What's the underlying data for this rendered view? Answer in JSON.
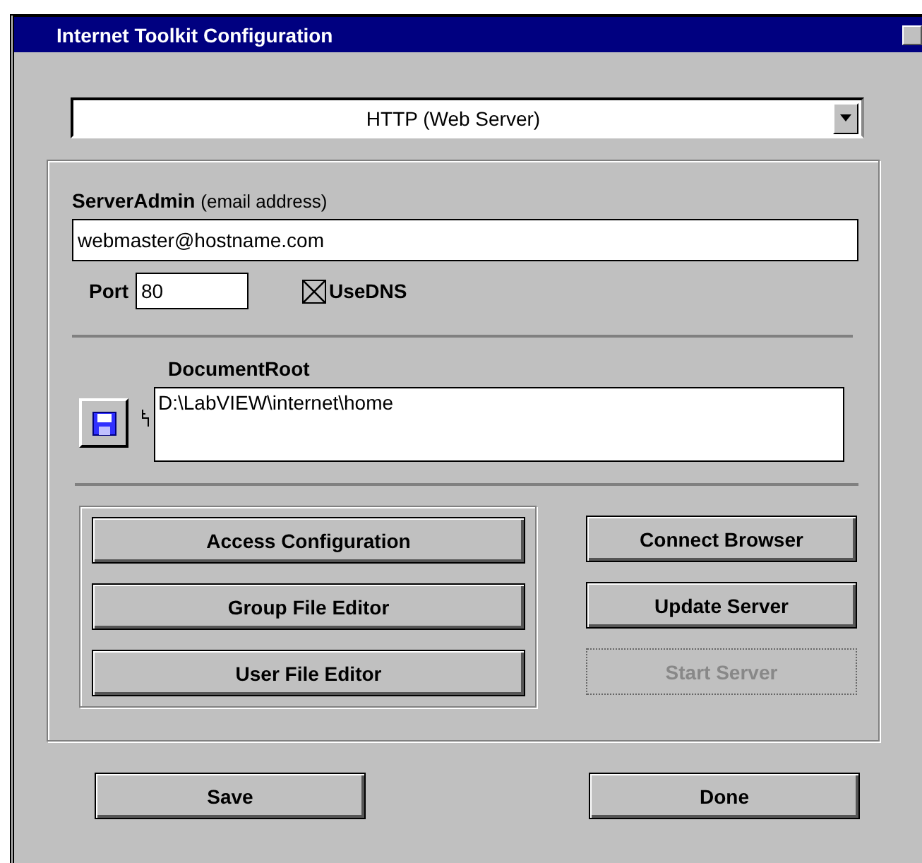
{
  "window": {
    "title": "Internet Toolkit Configuration"
  },
  "protocol": {
    "value": "HTTP (Web Server)"
  },
  "server_admin": {
    "label": "ServerAdmin",
    "hint": "(email address)",
    "value": "webmaster@hostname.com"
  },
  "port": {
    "label": "Port",
    "value": "80"
  },
  "use_dns": {
    "label": "UseDNS",
    "checked": true
  },
  "document_root": {
    "label": "DocumentRoot",
    "value": "D:\\LabVIEW\\internet\\home"
  },
  "editor_buttons": [
    {
      "label": "Access Configuration",
      "disabled": false
    },
    {
      "label": "Group File Editor",
      "disabled": false
    },
    {
      "label": "User File Editor",
      "disabled": false
    }
  ],
  "server_buttons": [
    {
      "label": "Connect Browser",
      "disabled": false
    },
    {
      "label": "Update Server",
      "disabled": false
    },
    {
      "label": "Start Server",
      "disabled": true
    }
  ],
  "footer_buttons": [
    {
      "label": "Save"
    },
    {
      "label": "Done"
    }
  ]
}
